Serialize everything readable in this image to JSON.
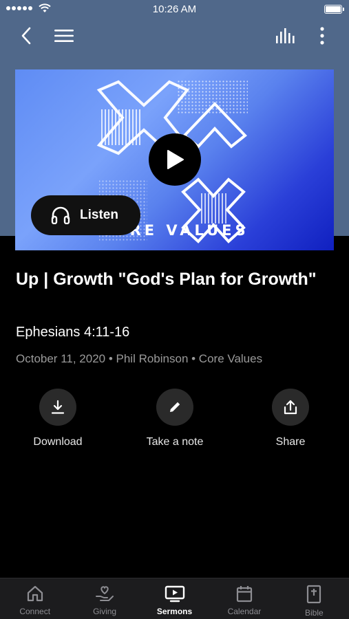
{
  "status_bar": {
    "time": "10:26 AM"
  },
  "nav": {
    "back_icon": "chevron-left-icon",
    "menu_icon": "hamburger-icon",
    "audio_icon": "equalizer-icon",
    "more_icon": "more-vertical-icon"
  },
  "media": {
    "artwork_text": "CORE VALUES",
    "listen_label": "Listen",
    "accent_color": "#5a82ee"
  },
  "sermon": {
    "title": "Up | Growth  \"God's Plan for Growth\"",
    "scripture": "Ephesians 4:11-16",
    "meta": "October 11, 2020 • Phil Robinson • Core Values"
  },
  "actions": [
    {
      "label": "Download",
      "icon": "download-icon"
    },
    {
      "label": "Take a note",
      "icon": "pencil-icon"
    },
    {
      "label": "Share",
      "icon": "share-icon"
    }
  ],
  "tabs": [
    {
      "label": "Connect",
      "icon": "home-icon",
      "active": false
    },
    {
      "label": "Giving",
      "icon": "giving-hand-icon",
      "active": false
    },
    {
      "label": "Sermons",
      "icon": "tv-play-icon",
      "active": true
    },
    {
      "label": "Calendar",
      "icon": "calendar-icon",
      "active": false
    },
    {
      "label": "Bible",
      "icon": "bible-icon",
      "active": false
    }
  ]
}
